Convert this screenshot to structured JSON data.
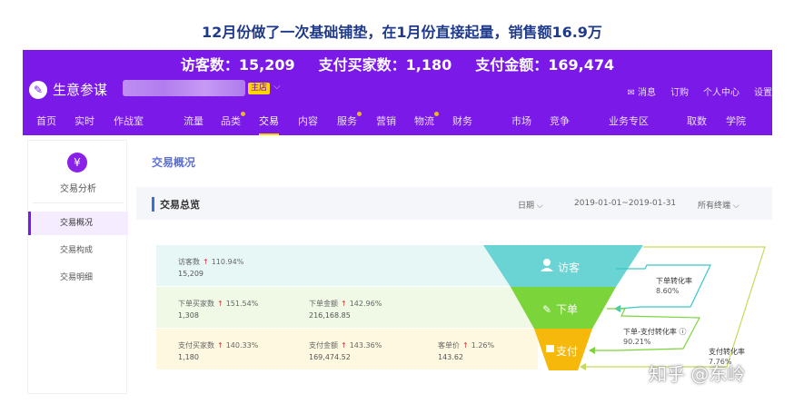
{
  "caption": "12月份做了一次基础铺垫，在1月份直接起量，销售额16.9万",
  "banner": {
    "visitors": "访客数：15,209",
    "buyers": "支付买家数：1,180",
    "amount": "支付金额：169,474"
  },
  "app": {
    "logo_label": "生意参谋",
    "shop_badge": "主店",
    "top_links": [
      "消息",
      "订购",
      "个人中心",
      "设置"
    ]
  },
  "nav": {
    "items": [
      "首页",
      "实时",
      "作战室",
      "流量",
      "品类",
      "交易",
      "内容",
      "服务",
      "营销",
      "物流",
      "财务",
      "市场",
      "竞争",
      "业务专区",
      "取数",
      "学院"
    ],
    "active": "交易"
  },
  "sidebar": {
    "title": "交易分析",
    "items": [
      "交易概况",
      "交易构成",
      "交易明细"
    ],
    "active": "交易概况"
  },
  "main": {
    "title": "交易概况",
    "section_title": "交易总览",
    "date_label": "日期",
    "date_range": "2019-01-01~2019-01-31",
    "terminal_label": "所有终端"
  },
  "metrics": {
    "visitors": {
      "label": "访客数",
      "change": "110.94%",
      "value": "15,209"
    },
    "order_buyers": {
      "label": "下单买家数",
      "change": "151.54%",
      "value": "1,308"
    },
    "order_amount": {
      "label": "下单金额",
      "change": "142.96%",
      "value": "216,168.85"
    },
    "pay_buyers": {
      "label": "支付买家数",
      "change": "140.33%",
      "value": "1,180"
    },
    "pay_amount": {
      "label": "支付金额",
      "change": "143.36%",
      "value": "169,474.52"
    },
    "avg_price": {
      "label": "客单价",
      "change": "1.26%",
      "value": "143.62"
    }
  },
  "funnel": {
    "visit": "访客",
    "order": "下单",
    "pay": "支付"
  },
  "rates": {
    "visit_to_order": {
      "label": "下单转化率",
      "value": "8.60%"
    },
    "order_to_pay": {
      "label": "下单-支付转化率",
      "value": "90.21%"
    },
    "visit_to_pay": {
      "label": "支付转化率",
      "value": "7.76%"
    }
  },
  "colors": {
    "purple": "#7a19e8",
    "visit_teal": "#6ad3d3",
    "order_green": "#7bd43a",
    "pay_yellow": "#f6b80b",
    "increase_red": "#e0302a"
  },
  "watermark": "知乎 @东岭"
}
